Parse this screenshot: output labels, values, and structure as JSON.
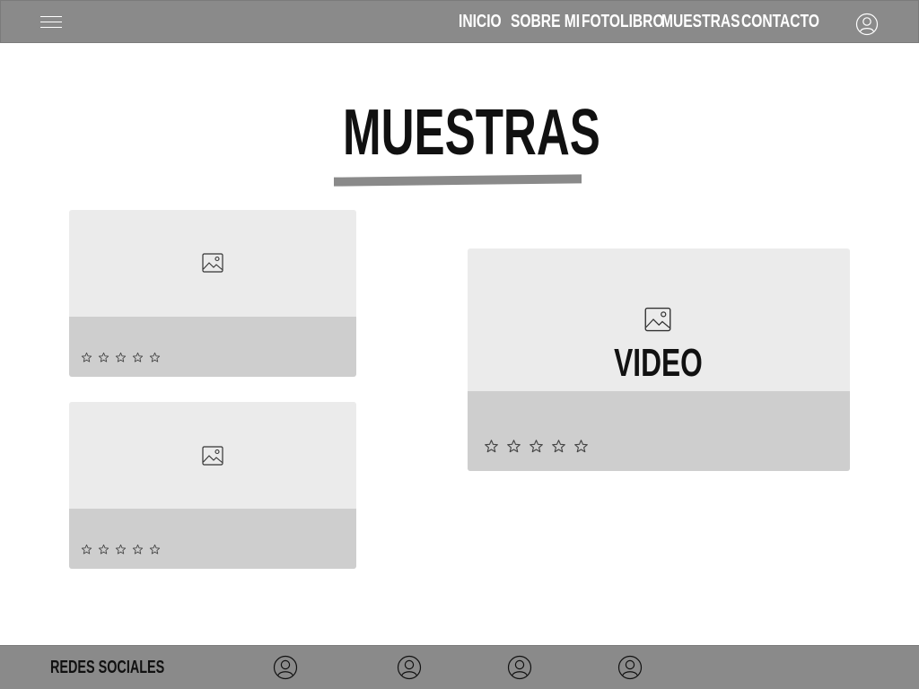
{
  "nav": {
    "items": [
      {
        "label": "INICIO"
      },
      {
        "label": "SOBRE MI"
      },
      {
        "label": "FOTOLIBRO"
      },
      {
        "label": "MUESTRAS"
      },
      {
        "label": "CONTACTO"
      }
    ],
    "menu_icon": "hamburger-menu-icon",
    "account_icon": "user-icon"
  },
  "page": {
    "title": "MUESTRAS"
  },
  "cards": [
    {
      "media_icon": "image-icon",
      "rating": 0,
      "max_rating": 5
    },
    {
      "media_icon": "image-icon",
      "rating": 0,
      "max_rating": 5
    },
    {
      "media_icon": "image-icon",
      "label": "VIDEO",
      "rating": 0,
      "max_rating": 5
    }
  ],
  "footer": {
    "label": "REDES SOCIALES",
    "social_icons": [
      "user-icon",
      "user-icon",
      "user-icon",
      "user-icon"
    ]
  },
  "colors": {
    "bar": "#8a8a8a",
    "card_background": "#ebebeb",
    "card_footer": "#cecece",
    "text_dark": "#111111",
    "text_light": "#ffffff"
  }
}
